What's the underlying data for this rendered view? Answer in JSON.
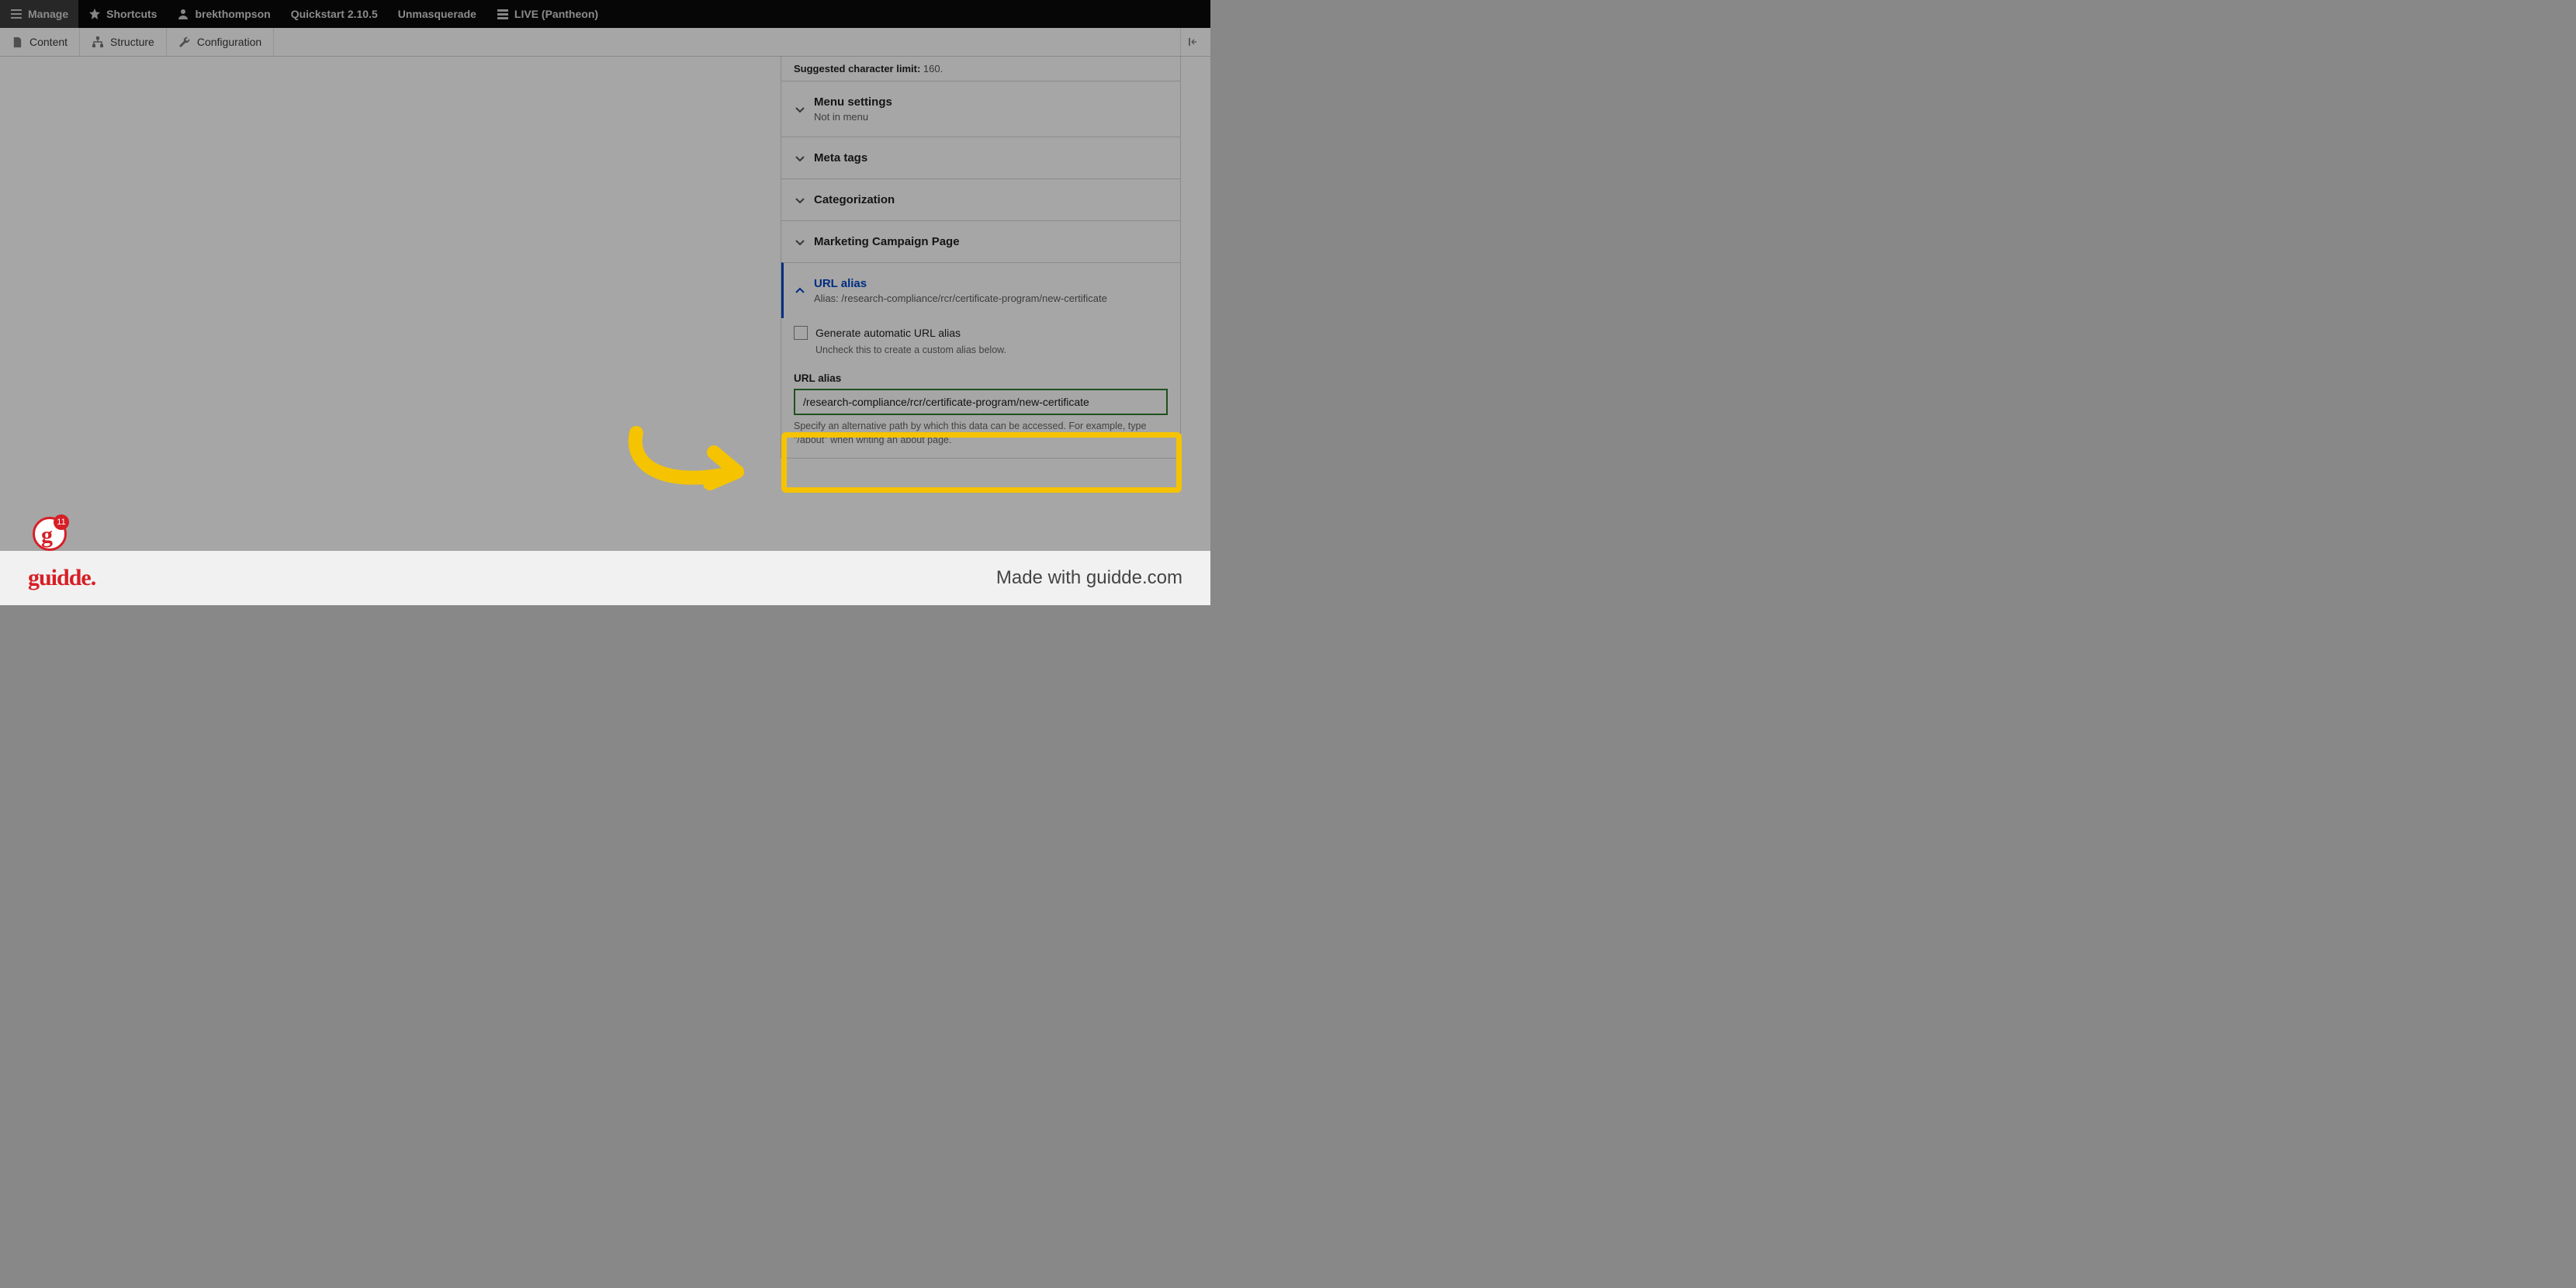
{
  "topbar": {
    "manage": "Manage",
    "shortcuts": "Shortcuts",
    "user": "brekthompson",
    "quickstart": "Quickstart 2.10.5",
    "unmasquerade": "Unmasquerade",
    "live": "LIVE (Pantheon)"
  },
  "secondbar": {
    "content": "Content",
    "structure": "Structure",
    "configuration": "Configuration"
  },
  "sidebar": {
    "suggested_label": "Suggested character limit:",
    "suggested_value": " 160.",
    "menu_settings": {
      "title": "Menu settings",
      "sub": "Not in menu"
    },
    "meta_tags": {
      "title": "Meta tags"
    },
    "categorization": {
      "title": "Categorization"
    },
    "marketing": {
      "title": "Marketing Campaign Page"
    },
    "url_alias": {
      "title": "URL alias",
      "sub_prefix": "Alias: ",
      "sub_value": "/research-compliance/rcr/certificate-program/new-certificate",
      "generate_label": "Generate automatic URL alias",
      "generate_help": "Uncheck this to create a custom alias below.",
      "field_label": "URL alias",
      "field_value": "/research-compliance/rcr/certificate-program/new-certificate",
      "field_help": "Specify an alternative path by which this data can be accessed. For example, type \"/about\" when writing an about page."
    }
  },
  "notif": {
    "count": "11",
    "letter": "g"
  },
  "footer": {
    "logo": "guidde.",
    "made": "Made with guidde.com"
  }
}
